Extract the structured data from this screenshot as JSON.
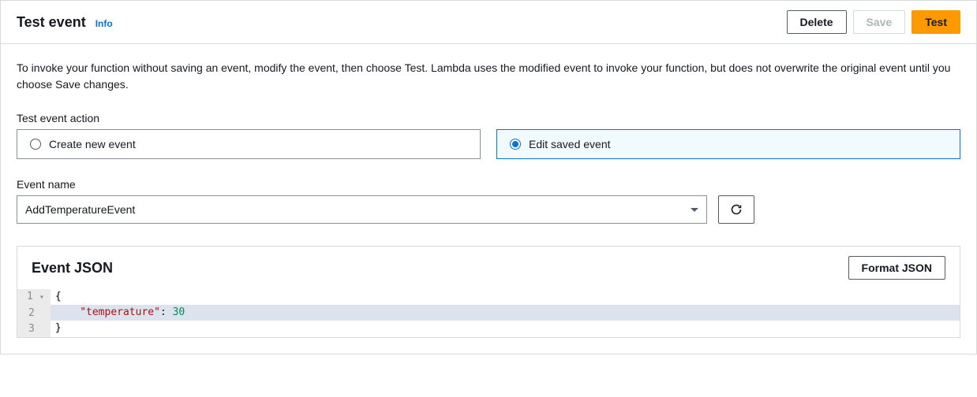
{
  "header": {
    "title": "Test event",
    "info_label": "Info",
    "delete_label": "Delete",
    "save_label": "Save",
    "test_label": "Test"
  },
  "description": "To invoke your function without saving an event, modify the event, then choose Test. Lambda uses the modified event to invoke your function, but does not overwrite the original event until you choose Save changes.",
  "action": {
    "label": "Test event action",
    "create_label": "Create new event",
    "edit_label": "Edit saved event",
    "selected": "edit"
  },
  "event_name": {
    "label": "Event name",
    "value": "AddTemperatureEvent"
  },
  "json_section": {
    "title": "Event JSON",
    "format_label": "Format JSON",
    "lines": {
      "l1_num": "1",
      "l2_num": "2",
      "l3_num": "3",
      "l1_text": "{",
      "l2_key": "\"temperature\"",
      "l2_colon": ": ",
      "l2_value": "30",
      "l3_text": "}"
    }
  }
}
